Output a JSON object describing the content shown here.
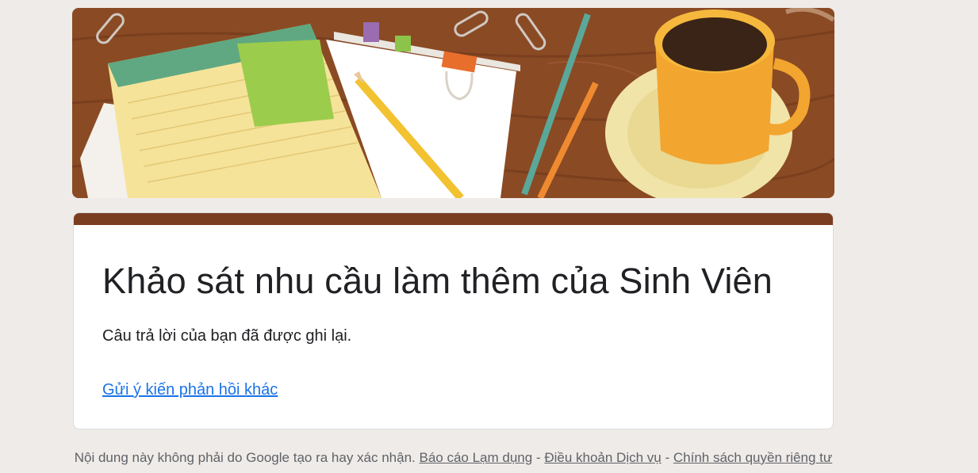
{
  "form": {
    "title": "Khảo sát nhu cầu làm thêm của Sinh Viên",
    "confirmation_message": "Câu trả lời của bạn đã được ghi lại.",
    "submit_another_link": "Gửi ý kiến phản hồi khác",
    "accent_color": "#7b3d20"
  },
  "footer": {
    "disclaimer": "Nội dung này không phải do Google tạo ra hay xác nhận.",
    "report_abuse": "Báo cáo Lạm dụng",
    "separator1": " - ",
    "terms": "Điều khoản Dịch vụ",
    "separator2": " - ",
    "privacy": "Chính sách quyền riêng tư"
  }
}
